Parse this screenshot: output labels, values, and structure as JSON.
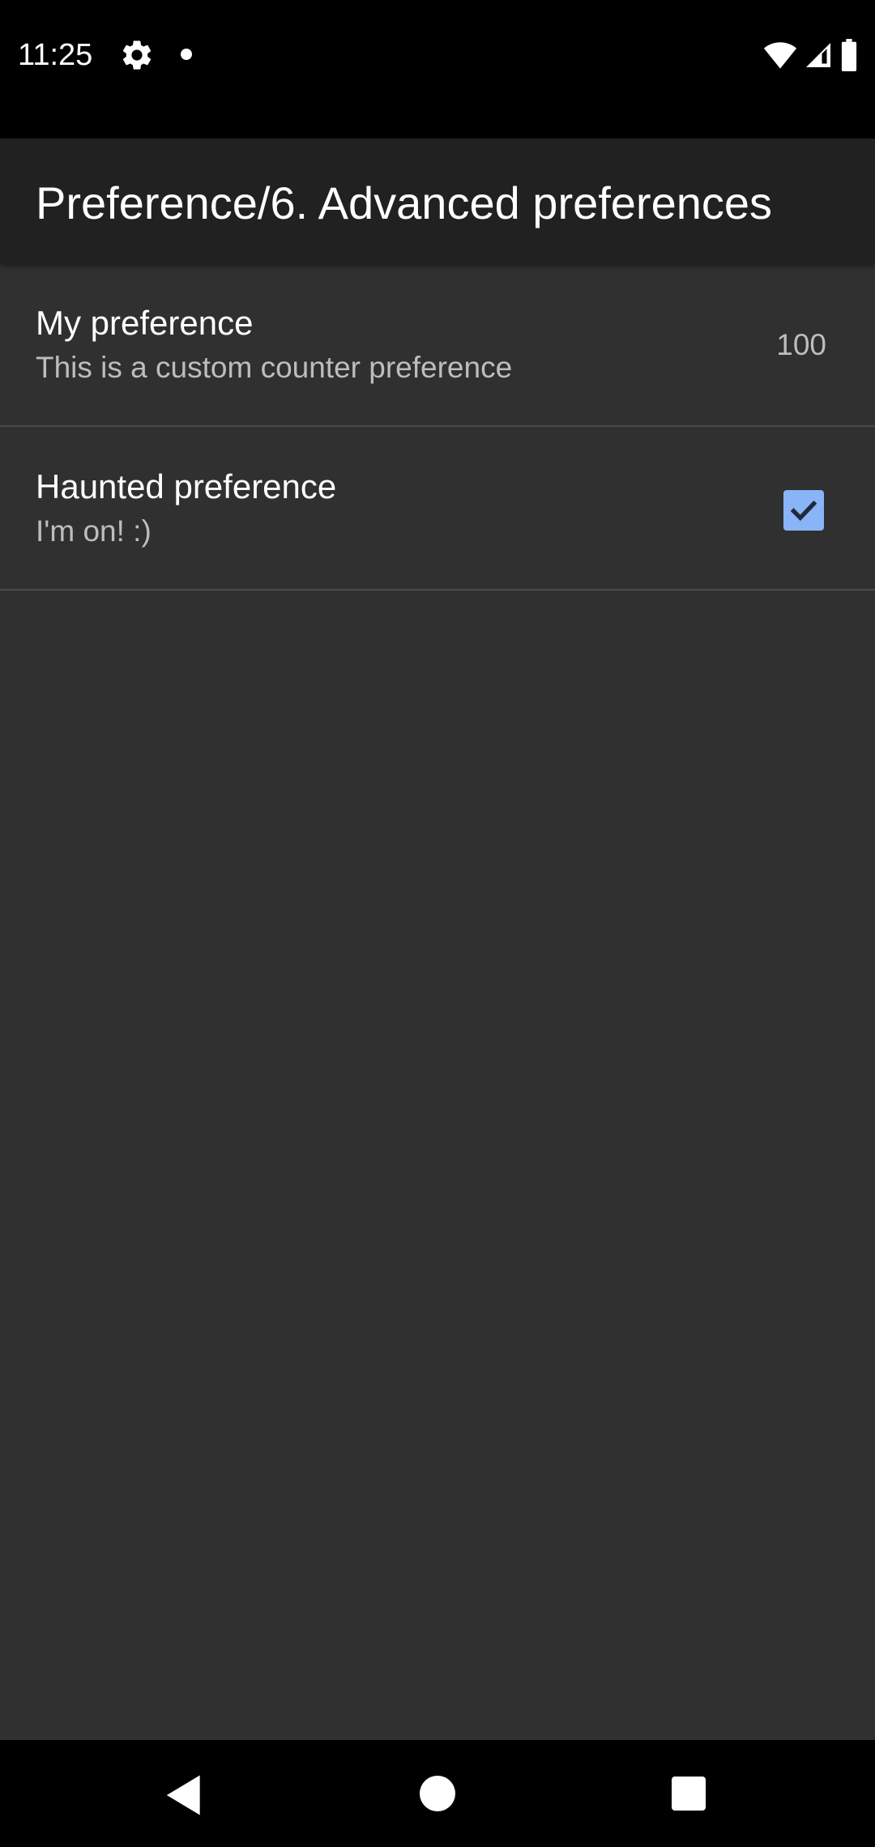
{
  "status_bar": {
    "time": "11:25",
    "icons": [
      "settings-gear-icon",
      "notification-dot-icon",
      "wifi-icon",
      "cell-signal-icon",
      "battery-icon"
    ]
  },
  "app_bar": {
    "title": "Preference/6. Advanced preferences"
  },
  "preferences": [
    {
      "title": "My preference",
      "summary": "This is a custom counter preference",
      "value": "100"
    },
    {
      "title": "Haunted preference",
      "summary": "I'm on! :)",
      "checked": true
    }
  ],
  "colors": {
    "background": "#303030",
    "app_bar": "#212121",
    "checkbox_accent": "#8ab4f8",
    "primary_text": "#ffffff",
    "secondary_text": "#bdbdbd"
  },
  "nav_bar": {
    "buttons": [
      "back-icon",
      "home-icon",
      "recents-icon"
    ]
  }
}
